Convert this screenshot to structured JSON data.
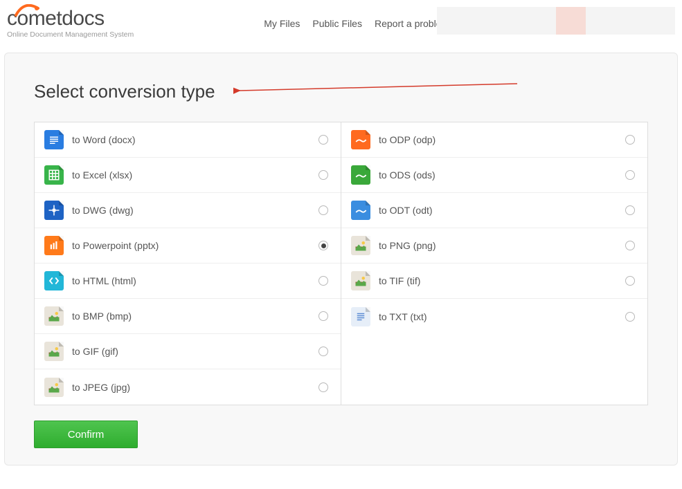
{
  "logo": {
    "text": "cometdocs",
    "tagline": "Online Document Management System"
  },
  "nav": {
    "my_files": "My Files",
    "public_files": "Public Files",
    "report": "Report a problem"
  },
  "panel": {
    "title": "Select conversion type",
    "confirm": "Confirm"
  },
  "conversions": {
    "left": [
      {
        "label": "to Word (docx)",
        "slug": "word",
        "color": "#2a7de1",
        "checked": false
      },
      {
        "label": "to Excel (xlsx)",
        "slug": "excel",
        "color": "#38b44a",
        "checked": false
      },
      {
        "label": "to DWG (dwg)",
        "slug": "dwg",
        "color": "#1e63c4",
        "checked": false
      },
      {
        "label": "to Powerpoint (pptx)",
        "slug": "pptx",
        "color": "#ff7a1a",
        "checked": true
      },
      {
        "label": "to HTML (html)",
        "slug": "html",
        "color": "#22b7d8",
        "checked": false
      },
      {
        "label": "to BMP (bmp)",
        "slug": "bmp",
        "color": "#e9e4da",
        "checked": false
      },
      {
        "label": "to GIF (gif)",
        "slug": "gif",
        "color": "#e9e4da",
        "checked": false
      },
      {
        "label": "to JPEG (jpg)",
        "slug": "jpeg",
        "color": "#e9e4da",
        "checked": false
      }
    ],
    "right": [
      {
        "label": "to ODP (odp)",
        "slug": "odp",
        "color": "#ff6a1f",
        "checked": false
      },
      {
        "label": "to ODS (ods)",
        "slug": "ods",
        "color": "#3aa83a",
        "checked": false
      },
      {
        "label": "to ODT (odt)",
        "slug": "odt",
        "color": "#3a8de0",
        "checked": false
      },
      {
        "label": "to PNG (png)",
        "slug": "png",
        "color": "#e9e4da",
        "checked": false
      },
      {
        "label": "to TIF (tif)",
        "slug": "tif",
        "color": "#e9e4da",
        "checked": false
      },
      {
        "label": "to TXT (txt)",
        "slug": "txt",
        "color": "#e6eef8",
        "checked": false
      }
    ]
  }
}
